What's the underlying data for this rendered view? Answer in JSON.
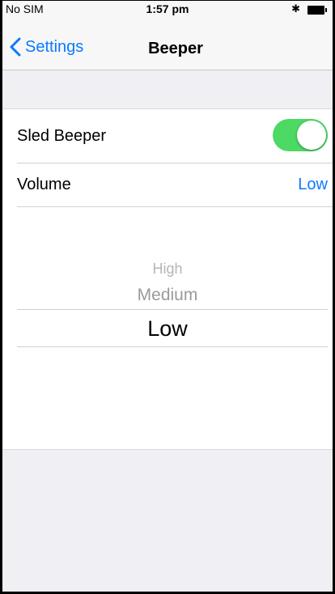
{
  "status_bar": {
    "carrier": "No SIM",
    "time": "1:57 pm",
    "bluetooth_icon": "bluetooth-icon",
    "battery_icon": "battery-icon"
  },
  "nav": {
    "back_label": "Settings",
    "title": "Beeper",
    "back_icon": "chevron-left-icon"
  },
  "settings": {
    "sled_beeper": {
      "label": "Sled Beeper",
      "enabled": true
    },
    "volume": {
      "label": "Volume",
      "value": "Low"
    }
  },
  "picker": {
    "options": [
      "High",
      "Medium",
      "Low"
    ],
    "selected": "Low"
  },
  "colors": {
    "accent": "#0a7aff",
    "toggle_on": "#4cd964",
    "background": "#efeff4"
  }
}
